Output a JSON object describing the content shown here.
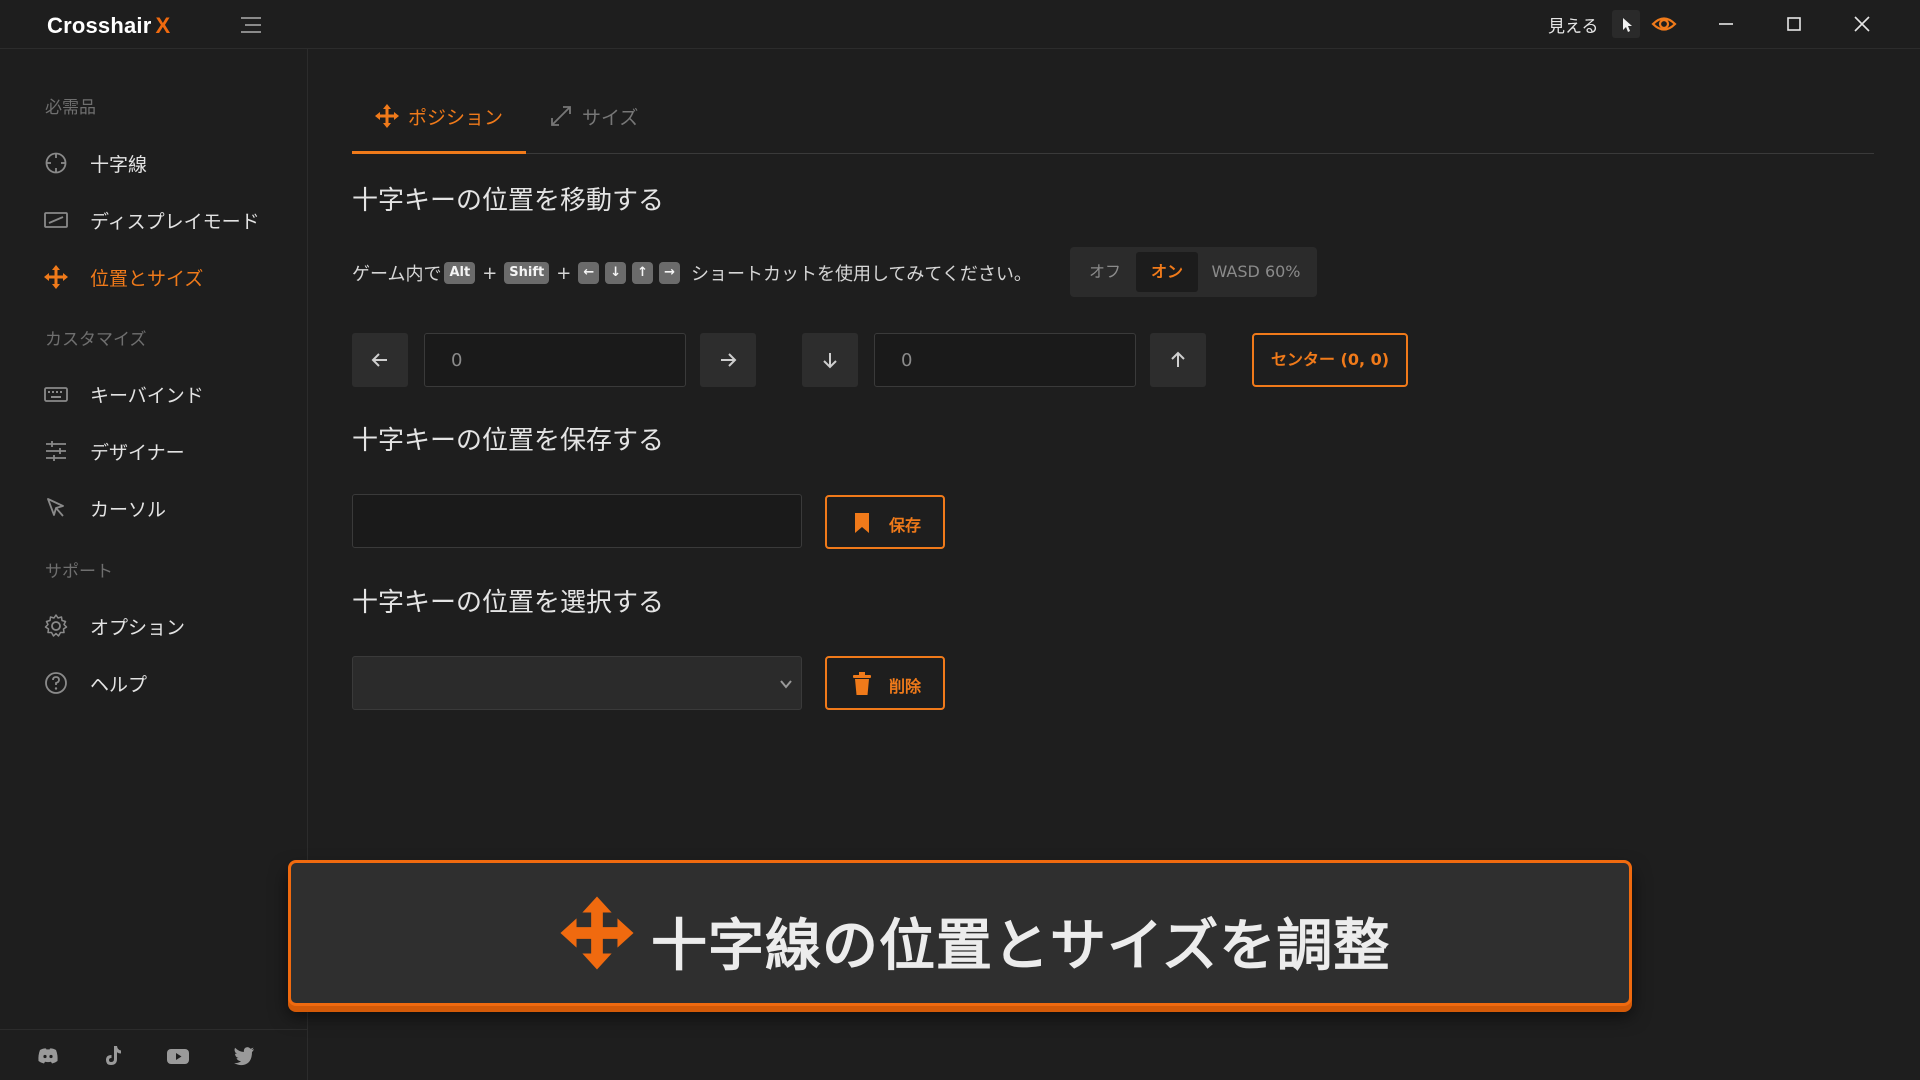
{
  "app": {
    "name": "Crosshair",
    "name_accent": "X"
  },
  "titlebar": {
    "visible_label": "見える"
  },
  "sidebar": {
    "sections": [
      "必需品",
      "カスタマイズ",
      "サポート"
    ],
    "items": [
      {
        "label": "十字線",
        "icon": "crosshair-icon"
      },
      {
        "label": "ディスプレイモード",
        "icon": "display-mode-icon"
      },
      {
        "label": "位置とサイズ",
        "icon": "move-icon",
        "active": true
      },
      {
        "label": "キーバインド",
        "icon": "keyboard-icon"
      },
      {
        "label": "デザイナー",
        "icon": "sliders-icon"
      },
      {
        "label": "カーソル",
        "icon": "cursor-icon"
      },
      {
        "label": "オプション",
        "icon": "gear-icon"
      },
      {
        "label": "ヘルプ",
        "icon": "help-icon"
      }
    ],
    "footer_icons": [
      "discord-icon",
      "tiktok-icon",
      "youtube-icon",
      "twitter-icon"
    ]
  },
  "tabs": [
    {
      "label": "ポジション",
      "active": true
    },
    {
      "label": "サイズ",
      "active": false
    }
  ],
  "move": {
    "heading": "十字キーの位置を移動する",
    "hint_prefix": "ゲーム内で",
    "keys": [
      "Alt",
      "Shift",
      "←",
      "↓",
      "↑",
      "→"
    ],
    "plus": "+",
    "hint_suffix": "ショートカットを使用してみてください。",
    "toggle_options": [
      "オフ",
      "オン",
      "WASD 60%"
    ],
    "toggle_selected": "オン",
    "x_value": "0",
    "y_value": "0",
    "center_label": "センター (0, 0)"
  },
  "save": {
    "heading": "十字キーの位置を保存する",
    "input_value": "",
    "button_label": "保存"
  },
  "select": {
    "heading": "十字キーの位置を選択する",
    "selected": "",
    "delete_label": "削除"
  },
  "banner": {
    "text": "十字線の位置とサイズを調整"
  },
  "colors": {
    "accent": "#f07a1a",
    "background": "#1e1e1e",
    "sidebar_text": "#e3e3e3",
    "muted": "#6f6f6f"
  }
}
